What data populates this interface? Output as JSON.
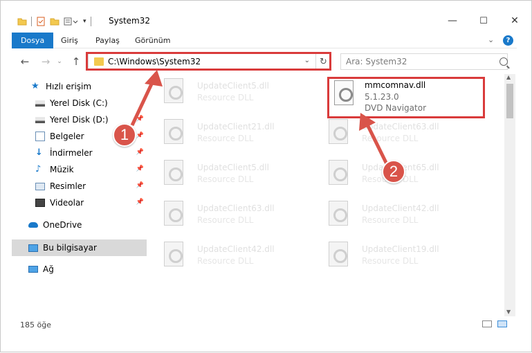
{
  "window": {
    "title": "System32",
    "minimize": "—",
    "maximize": "☐",
    "close": "✕"
  },
  "ribbon": {
    "tabs": [
      {
        "label": "Dosya",
        "active": true
      },
      {
        "label": "Giriş"
      },
      {
        "label": "Paylaş"
      },
      {
        "label": "Görünüm"
      }
    ]
  },
  "navigation": {
    "back": "←",
    "forward": "→",
    "up": "↑",
    "address": "C:\\Windows\\System32",
    "refresh": "↻",
    "search_placeholder": "Ara: System32"
  },
  "sidebar": {
    "items": [
      {
        "label": "Hızlı erişim",
        "icon": "star-icon"
      },
      {
        "label": "Yerel Disk (C:)",
        "icon": "drive-icon"
      },
      {
        "label": "Yerel Disk (D:)",
        "icon": "drive-icon"
      },
      {
        "label": "Belgeler",
        "icon": "documents-icon"
      },
      {
        "label": "İndirmeler",
        "icon": "download-icon"
      },
      {
        "label": "Müzik",
        "icon": "music-icon"
      },
      {
        "label": "Resimler",
        "icon": "pictures-icon"
      },
      {
        "label": "Videolar",
        "icon": "videos-icon"
      },
      {
        "label": "OneDrive",
        "icon": "cloud-icon"
      },
      {
        "label": "Bu bilgisayar",
        "icon": "computer-icon",
        "selected": true
      },
      {
        "label": "Ağ",
        "icon": "network-icon"
      }
    ]
  },
  "files": {
    "highlighted": {
      "name": "mmcomnav.dll",
      "version": "5.1.23.0",
      "description": "DVD Navigator"
    },
    "faded": [
      {
        "name": "UpdateClient5.dll",
        "desc": "Resource DLL"
      },
      {
        "name": "UpdateClient21.dll",
        "desc": "Resource DLL"
      },
      {
        "name": "UpdateClient63.dll",
        "desc": "Resource DLL"
      },
      {
        "name": "UpdateClient5.dll",
        "desc": "Resource DLL"
      },
      {
        "name": "UpdateClient65.dll",
        "desc": "Resource DLL"
      },
      {
        "name": "UpdateClient63.dll",
        "desc": "Resource DLL"
      },
      {
        "name": "UpdateClient42.dll",
        "desc": "Resource DLL"
      },
      {
        "name": "UpdateClient42.dll",
        "desc": "Resource DLL"
      },
      {
        "name": "UpdateClient19.dll",
        "desc": "Resource DLL"
      }
    ]
  },
  "status": {
    "count": "185 öğe"
  },
  "annotations": {
    "step1": "1",
    "step2": "2",
    "color": "#d9544a"
  }
}
